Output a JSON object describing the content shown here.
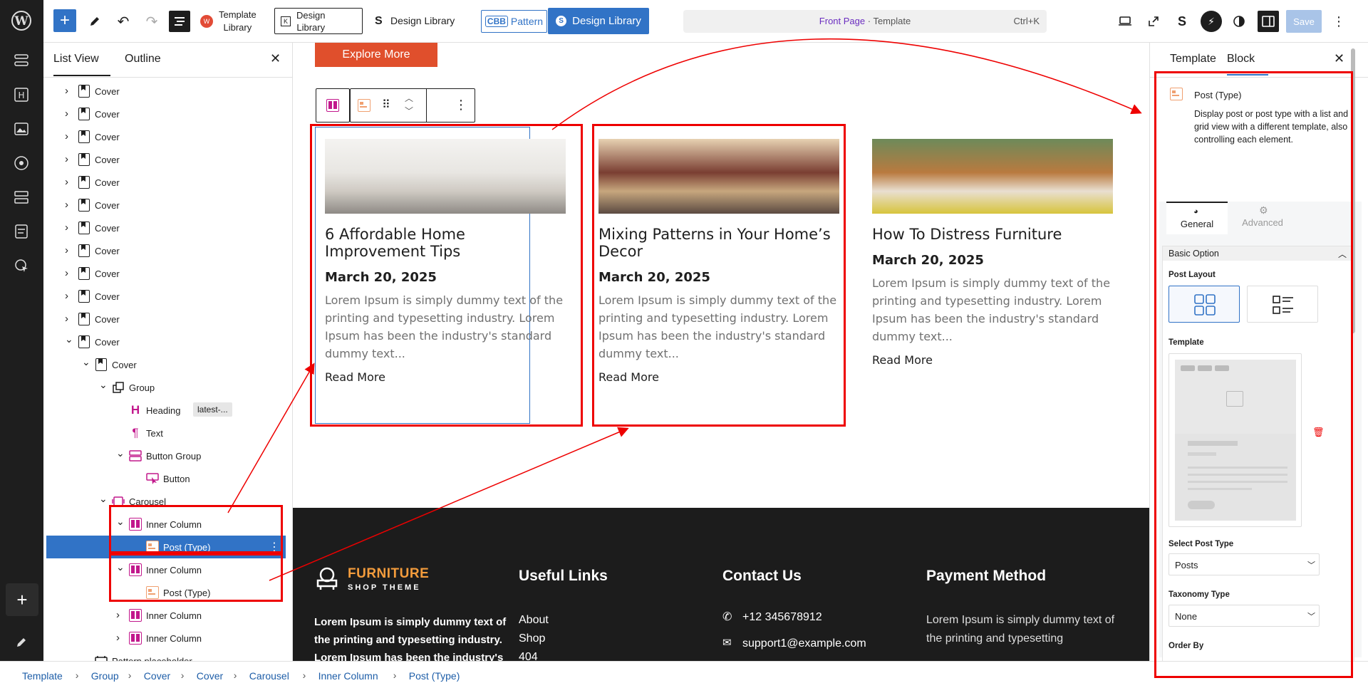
{
  "topbar": {
    "template_library": [
      "Template",
      "Library"
    ],
    "design_library_btn": [
      "Design",
      "Library"
    ],
    "design_library_link": "Design Library",
    "pattern": "Pattern",
    "pattern_badge": "CBB",
    "design_library_primary": "Design Library",
    "doc_title_page": "Front Page",
    "doc_title_sep": " · ",
    "doc_title_type": "Template",
    "shortcut": "Ctrl+K",
    "save": "Save"
  },
  "listview": {
    "tab_list": "List View",
    "tab_outline": "Outline",
    "rows": [
      {
        "label": "Cover",
        "icon": "cover-icon",
        "indent": 0,
        "chev": "›"
      },
      {
        "label": "Cover",
        "icon": "cover-icon",
        "indent": 0,
        "chev": "›"
      },
      {
        "label": "Cover",
        "icon": "cover-icon",
        "indent": 0,
        "chev": "›"
      },
      {
        "label": "Cover",
        "icon": "cover-icon",
        "indent": 0,
        "chev": "›"
      },
      {
        "label": "Cover",
        "icon": "cover-icon",
        "indent": 0,
        "chev": "›"
      },
      {
        "label": "Cover",
        "icon": "cover-icon",
        "indent": 0,
        "chev": "›"
      },
      {
        "label": "Cover",
        "icon": "cover-icon",
        "indent": 0,
        "chev": "›"
      },
      {
        "label": "Cover",
        "icon": "cover-icon",
        "indent": 0,
        "chev": "›"
      },
      {
        "label": "Cover",
        "icon": "cover-icon",
        "indent": 0,
        "chev": "›"
      },
      {
        "label": "Cover",
        "icon": "cover-icon",
        "indent": 0,
        "chev": "›"
      },
      {
        "label": "Cover",
        "icon": "cover-icon",
        "indent": 0,
        "chev": "›"
      },
      {
        "label": "Cover",
        "icon": "cover-icon",
        "indent": 0,
        "chev": "⌄"
      },
      {
        "label": "Cover",
        "icon": "cover-icon",
        "indent": 1,
        "chev": "⌄"
      },
      {
        "label": "Group",
        "icon": "group-icon",
        "indent": 2,
        "chev": "⌄"
      },
      {
        "label": "Heading",
        "icon": "heading-icon",
        "indent": 3,
        "chev": "",
        "badge": "latest-..."
      },
      {
        "label": "Text",
        "icon": "paragraph-icon",
        "indent": 3,
        "chev": ""
      },
      {
        "label": "Button Group",
        "icon": "button-group-icon",
        "indent": 3,
        "chev": "⌄"
      },
      {
        "label": "Button",
        "icon": "button-icon",
        "indent": 4,
        "chev": ""
      },
      {
        "label": "Carousel",
        "icon": "carousel-icon",
        "indent": 2,
        "chev": "⌄"
      },
      {
        "label": "Inner Column",
        "icon": "inner-column-icon",
        "indent": 3,
        "chev": "⌄"
      },
      {
        "label": "Post (Type)",
        "icon": "post-type-icon",
        "indent": 4,
        "chev": "",
        "selected": true
      },
      {
        "label": "Inner Column",
        "icon": "inner-column-icon",
        "indent": 3,
        "chev": "⌄"
      },
      {
        "label": "Post (Type)",
        "icon": "post-type-icon",
        "indent": 4,
        "chev": ""
      },
      {
        "label": "Inner Column",
        "icon": "inner-column-icon",
        "indent": 3,
        "chev": "›"
      },
      {
        "label": "Inner Column",
        "icon": "inner-column-icon",
        "indent": 3,
        "chev": "›"
      },
      {
        "label": "Pattern placeholder",
        "icon": "pattern-placeholder-icon",
        "indent": 1,
        "chev": ""
      }
    ]
  },
  "canvas": {
    "explore_button": "Explore More",
    "posts": [
      {
        "title": "6 Affordable Home Improvement Tips",
        "date": "March 20, 2025",
        "excerpt": "Lorem Ipsum is simply dummy text of the printing and typesetting industry. Lorem Ipsum has been the industry's standard dummy text...",
        "read_more": "Read More"
      },
      {
        "title": "Mixing Patterns in Your Home’s Decor",
        "date": "March 20, 2025",
        "excerpt": "Lorem Ipsum is simply dummy text of the printing and typesetting industry. Lorem Ipsum has been the industry's standard dummy text...",
        "read_more": "Read More"
      },
      {
        "title": "How To Distress Furniture",
        "date": "March 20, 2025",
        "excerpt": "Lorem Ipsum is simply dummy text of the printing and typesetting industry. Lorem Ipsum has been the industry's standard dummy text...",
        "read_more": "Read More"
      }
    ],
    "footer": {
      "brand_top": "FURNITURE",
      "brand_bottom": "SHOP THEME",
      "about_text": "Lorem Ipsum is simply dummy text of the printing and typesetting industry. Lorem Ipsum has been the industry's",
      "useful_links_title": "Useful Links",
      "links": [
        "About",
        "Shop",
        "404"
      ],
      "contact_title": "Contact Us",
      "phone": "+12 345678912",
      "email": "support1@example.com",
      "payment_title": "Payment Method",
      "payment_text": "Lorem Ipsum is simply dummy text of the printing and typesetting"
    }
  },
  "sidebar": {
    "tab_template": "Template",
    "tab_block": "Block",
    "block_name": "Post (Type)",
    "block_desc": "Display post or post type with a list and grid view with a different template, also controlling each element.",
    "tab_general": "General",
    "tab_advanced": "Advanced",
    "section_title": "Basic Option",
    "post_layout_label": "Post Layout",
    "template_label": "Template",
    "select_post_type_label": "Select Post Type",
    "select_post_type_value": "Posts",
    "taxonomy_label": "Taxonomy Type",
    "taxonomy_value": "None",
    "order_by_label": "Order By"
  },
  "breadcrumb": [
    "Template",
    "Group",
    "Cover",
    "Cover",
    "Carousel",
    "Inner Column",
    "Post (Type)"
  ],
  "colors": {
    "accent": "#3173c6",
    "selected_row": "#3173c6",
    "explore_btn": "#e04f2c",
    "annotation_red": "#e00000",
    "footer_bg": "#1c1c1c",
    "brand_orange": "#f39c3c"
  }
}
